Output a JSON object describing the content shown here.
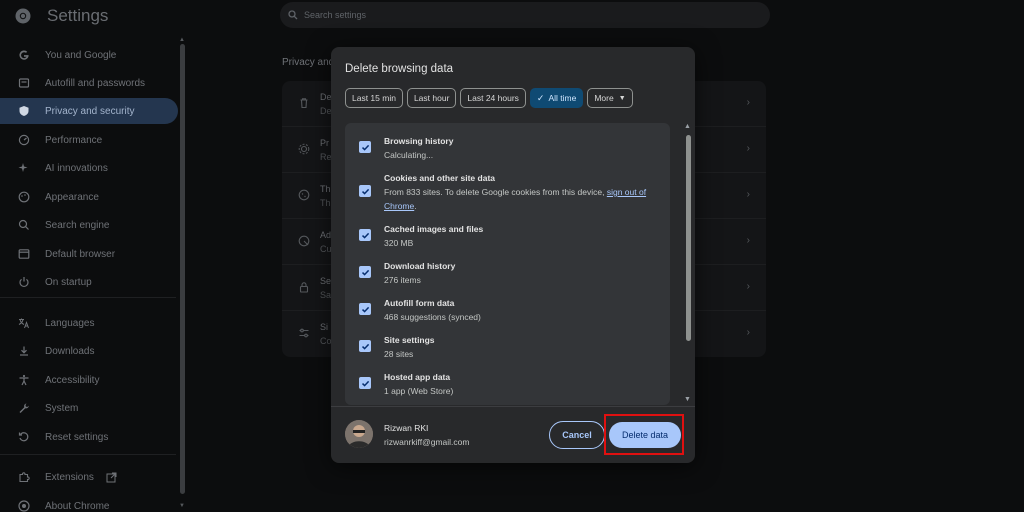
{
  "app": {
    "title": "Settings"
  },
  "search": {
    "placeholder": "Search settings"
  },
  "sidebar": {
    "items": [
      {
        "label": "You and Google",
        "icon": "google-icon"
      },
      {
        "label": "Autofill and passwords",
        "icon": "autofill-icon"
      },
      {
        "label": "Privacy and security",
        "icon": "shield-icon",
        "active": true
      },
      {
        "label": "Performance",
        "icon": "speedometer-icon"
      },
      {
        "label": "AI innovations",
        "icon": "sparkle-icon"
      },
      {
        "label": "Appearance",
        "icon": "palette-icon"
      },
      {
        "label": "Search engine",
        "icon": "search-icon"
      },
      {
        "label": "Default browser",
        "icon": "browser-icon"
      },
      {
        "label": "On startup",
        "icon": "power-icon"
      },
      {
        "label": "Languages",
        "icon": "translate-icon"
      },
      {
        "label": "Downloads",
        "icon": "download-icon"
      },
      {
        "label": "Accessibility",
        "icon": "accessibility-icon"
      },
      {
        "label": "System",
        "icon": "wrench-icon"
      },
      {
        "label": "Reset settings",
        "icon": "reset-icon"
      },
      {
        "label": "Extensions",
        "icon": "puzzle-icon"
      },
      {
        "label": "About Chrome",
        "icon": "chrome-icon"
      }
    ]
  },
  "background": {
    "section_title": "Privacy and",
    "rows": [
      {
        "icon": "trash-icon",
        "text1": "De",
        "text2": "De"
      },
      {
        "icon": "settings-icon",
        "text1": "Pr",
        "text2": "Re"
      },
      {
        "icon": "cookie-icon",
        "text1": "Th",
        "text2": "Th"
      },
      {
        "icon": "ads-icon",
        "text1": "Ad",
        "text2": "Cu"
      },
      {
        "icon": "lock-icon",
        "text1": "Se",
        "text2": "Sa"
      },
      {
        "icon": "sliders-icon",
        "text1": "Si",
        "text2": "Co"
      }
    ]
  },
  "dialog": {
    "title": "Delete browsing data",
    "time_chips": [
      {
        "label": "Last 15 min",
        "selected": false
      },
      {
        "label": "Last hour",
        "selected": false
      },
      {
        "label": "Last 24 hours",
        "selected": false
      },
      {
        "label": "All time",
        "selected": true
      },
      {
        "label": "More",
        "selected": false,
        "dropdown": true
      }
    ],
    "items": [
      {
        "label": "Browsing history",
        "desc": "Calculating...",
        "checked": true
      },
      {
        "label": "Cookies and other site data",
        "desc": "From 833 sites. To delete Google cookies from this device, ",
        "link": "sign out of Chrome",
        "desc_after": ".",
        "checked": true
      },
      {
        "label": "Cached images and files",
        "desc": "320 MB",
        "checked": true
      },
      {
        "label": "Download history",
        "desc": "276 items",
        "checked": true
      },
      {
        "label": "Autofill form data",
        "desc": "468 suggestions (synced)",
        "checked": true
      },
      {
        "label": "Site settings",
        "desc": "28 sites",
        "checked": true
      },
      {
        "label": "Hosted app data",
        "desc": "1 app (Web Store)",
        "checked": true
      }
    ],
    "account": {
      "name": "Rizwan RKI",
      "email": "rizwanrkiff@gmail.com"
    },
    "buttons": {
      "cancel": "Cancel",
      "delete": "Delete data"
    },
    "colors": {
      "accent": "#a8c7fa",
      "highlight": "#e01010"
    }
  }
}
